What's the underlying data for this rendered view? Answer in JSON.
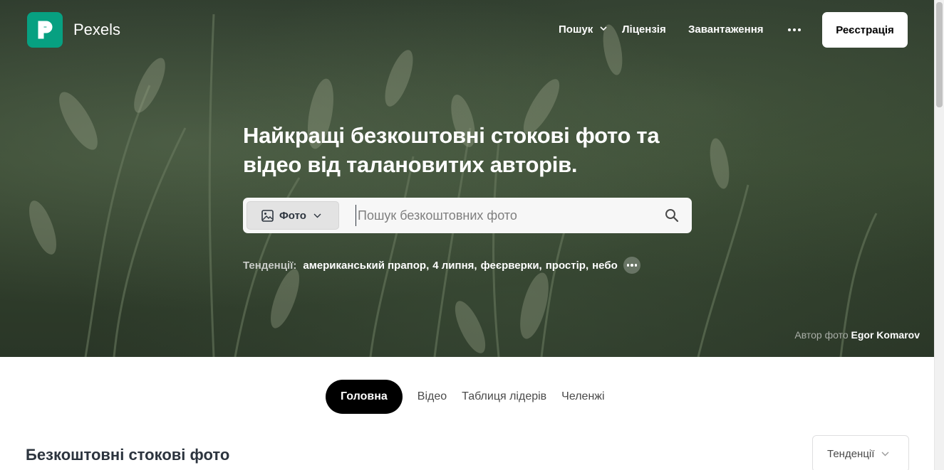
{
  "brand": {
    "name": "Pexels"
  },
  "nav": {
    "explore_label": "Пошук",
    "license_label": "Ліцензія",
    "upload_label": "Завантаження",
    "join_label": "Реєстрація"
  },
  "hero": {
    "headline": "Найкращі безкоштовні стокові фото та відео від талановитих авторів.",
    "search": {
      "type_label": "Фото",
      "placeholder": "Пошук безкоштовних фото",
      "value": ""
    },
    "trending": {
      "label": "Тенденції:",
      "items": [
        "американський прапор",
        "4 липня",
        "феєрверки",
        "простір",
        "небо"
      ]
    },
    "credit": {
      "label": "Автор фото",
      "name": "Egor Komarov"
    }
  },
  "tabs": [
    {
      "label": "Головна",
      "active": true
    },
    {
      "label": "Відео",
      "active": false
    },
    {
      "label": "Таблиця лідерів",
      "active": false
    },
    {
      "label": "Челенжі",
      "active": false
    }
  ],
  "feed": {
    "title": "Безкоштовні стокові фото",
    "sort_value": "Тенденції"
  },
  "colors": {
    "brand": "#07a081",
    "active_tab": "#000000",
    "text": "#2c343e"
  },
  "icons": [
    "pexels-logo-icon",
    "chevron-down-icon",
    "more-dots-icon",
    "image-icon",
    "search-icon"
  ]
}
